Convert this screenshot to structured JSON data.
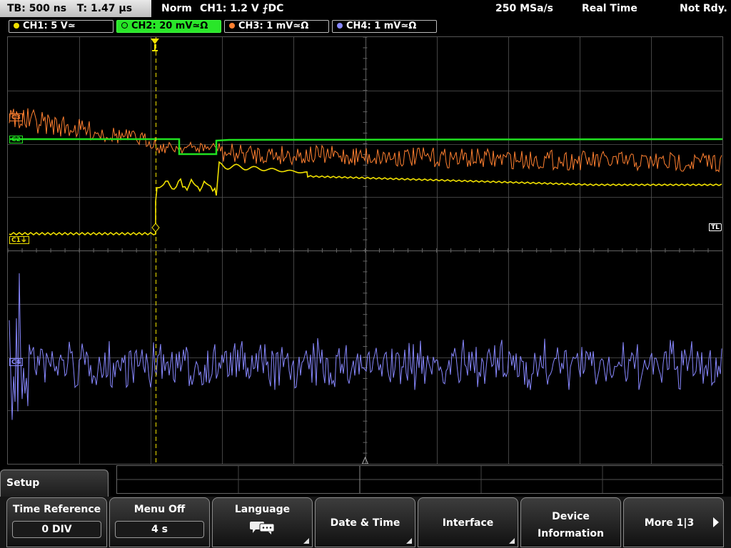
{
  "status_bar": {
    "timebase_label": "TB: 500 ns",
    "trigger_time": "T: 1.47 µs",
    "trigger_mode": "Norm",
    "trigger_info": "CH1: 1.2 V ⨍DC",
    "sample_rate": "250 MSa/s",
    "acq_mode": "Real Time",
    "status": "Not Rdy."
  },
  "channels": [
    {
      "label": "CH1: 5 V≃",
      "color": "#f0e000",
      "active": false
    },
    {
      "label": "CH2: 20 mV≃Ω",
      "color": "#20e020",
      "active": true
    },
    {
      "label": "CH3: 1 mV≃Ω",
      "color": "#ff8030",
      "active": false
    },
    {
      "label": "CH4: 1 mV≃Ω",
      "color": "#8888ff",
      "active": false
    }
  ],
  "screen_markers": {
    "ch1_ground": "C1⏚",
    "ch3": "C3",
    "ch2": "C2",
    "ch4": "C4",
    "trigger_level": "TL"
  },
  "menu": {
    "title": "Setup",
    "softkeys": [
      {
        "label": "Time Reference",
        "value": "0 DIV"
      },
      {
        "label": "Menu Off",
        "value": "4 s"
      },
      {
        "label": "Language",
        "icon": "speech-bubbles-icon"
      },
      {
        "label": "Date & Time"
      },
      {
        "label": "Interface"
      },
      {
        "label_line1": "Device",
        "label_line2": "Information"
      },
      {
        "label": "More 1|3"
      }
    ]
  },
  "colors": {
    "ch1": "#f0e000",
    "ch2": "#20e020",
    "ch3": "#ff8030",
    "ch4": "#8888ff",
    "grid": "#555555"
  }
}
